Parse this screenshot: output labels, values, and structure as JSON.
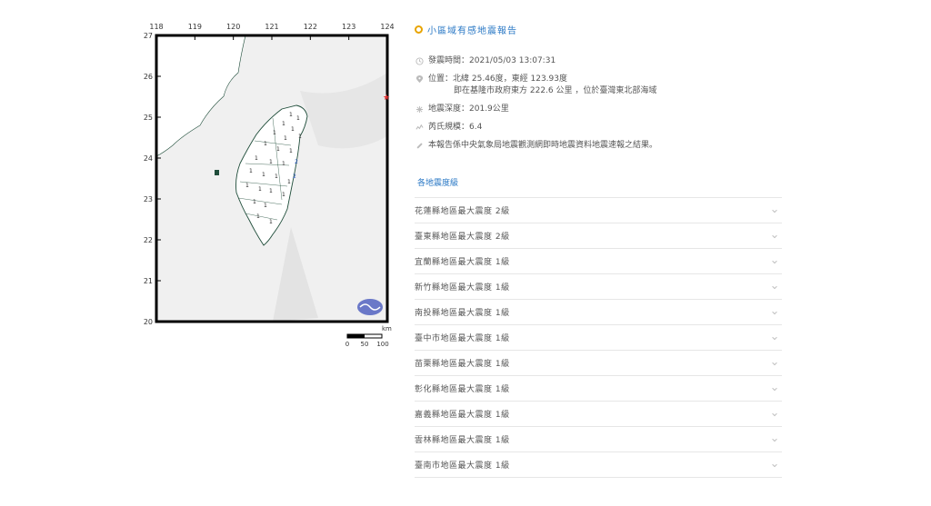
{
  "map": {
    "lon_ticks": [
      "118",
      "119",
      "120",
      "121",
      "122",
      "123",
      "124"
    ],
    "lat_ticks": [
      "27",
      "26",
      "25",
      "24",
      "23",
      "22",
      "21",
      "20"
    ],
    "scale_unit": "km",
    "scale_labels": [
      "0",
      "50",
      "100"
    ],
    "epicenter_icon": "star-icon",
    "logo_icon": "cwb-logo-icon",
    "intensity_marks": [
      "1",
      "1",
      "1",
      "1",
      "1",
      "1",
      "1",
      "1",
      "1",
      "1",
      "1",
      "1",
      "1",
      "1",
      "1",
      "1",
      "1",
      "1",
      "1",
      "1",
      "1",
      "1",
      "1",
      "1",
      "1",
      "2",
      "2"
    ],
    "colors": {
      "land": "#ffffff",
      "sea": "#efefef",
      "border": "#1f4d3a",
      "epicenter": "#e03030"
    }
  },
  "report": {
    "title": "小區域有感地震報告",
    "issue_label": "發震時間：",
    "issue_time": "2021/05/03 13:07:31",
    "location_label": "位置：",
    "location_coord": "北緯 25.46度，東經 123.93度",
    "location_desc": "即在基隆市政府東方 222.6 公里 ，位於臺灣東北部海域",
    "depth_label": "地震深度：",
    "depth_value": "201.9公里",
    "magnitude_label": "芮氏規模：",
    "magnitude_value": "6.4",
    "note": "本報告係中央氣象局地震觀測網即時地震資料地震速報之結果。",
    "section_label": "各地震度級",
    "intensities": [
      "花蓮縣地區最大震度 2級",
      "臺東縣地區最大震度 2級",
      "宜蘭縣地區最大震度 1級",
      "新竹縣地區最大震度 1級",
      "南投縣地區最大震度 1級",
      "臺中市地區最大震度 1級",
      "苗栗縣地區最大震度 1級",
      "彰化縣地區最大震度 1級",
      "嘉義縣地區最大震度 1級",
      "雲林縣地區最大震度 1級",
      "臺南市地區最大震度 1級"
    ],
    "accent_color": "#2a78c5",
    "dot_color": "#e8a400"
  }
}
